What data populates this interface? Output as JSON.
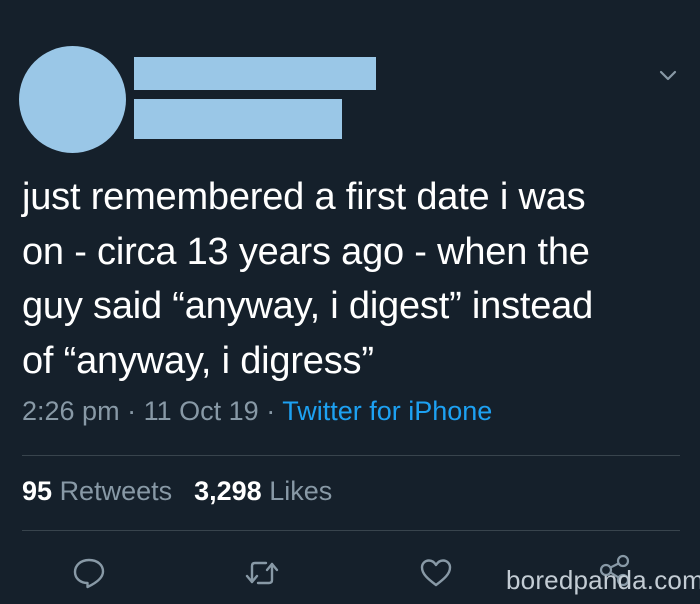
{
  "tweet": {
    "text_lines": [
      "just remembered a first date i was",
      "on - circa 13 years ago - when the",
      "guy said “anyway, i digest” instead",
      "of “anyway, i digress”"
    ],
    "time": "2:26 pm",
    "separator": "·",
    "date": "11 Oct 19",
    "source": "Twitter for iPhone"
  },
  "stats": {
    "retweets_count": "95",
    "retweets_label": "Retweets",
    "likes_count": "3,298",
    "likes_label": "Likes"
  },
  "actions": {
    "reply_icon": "reply-icon",
    "retweet_icon": "retweet-icon",
    "like_icon": "heart-icon",
    "share_icon": "share-icon"
  },
  "watermark": "boredpanda.com",
  "colors": {
    "background": "#15202b",
    "text": "#ffffff",
    "secondary": "#8899a6",
    "link": "#1da1f2",
    "redaction": "#9ac7e7",
    "divider": "#38444d"
  }
}
